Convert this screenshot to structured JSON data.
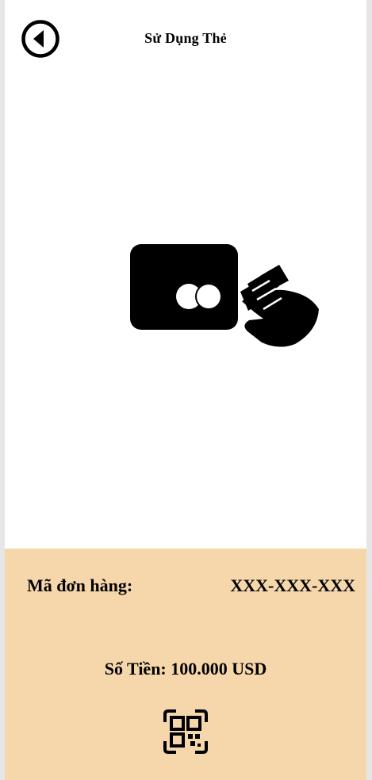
{
  "header": {
    "title": "Sử Dụng Thẻ",
    "back_icon": "back-arrow-circle-icon"
  },
  "illustration": {
    "card_icon": "payment-card-icon",
    "hand_icon": "hand-tap-icon"
  },
  "footer": {
    "order_label": "Mã đơn hàng:",
    "order_value": "XXX-XXX-XXX",
    "amount_text": "Số Tiền: 100.000 USD",
    "qr_icon": "qr-scan-icon"
  },
  "colors": {
    "footer_background": "#f6d7ab",
    "page_background": "#ffffff",
    "side_margin": "#e6e6e6",
    "foreground": "#000000"
  }
}
